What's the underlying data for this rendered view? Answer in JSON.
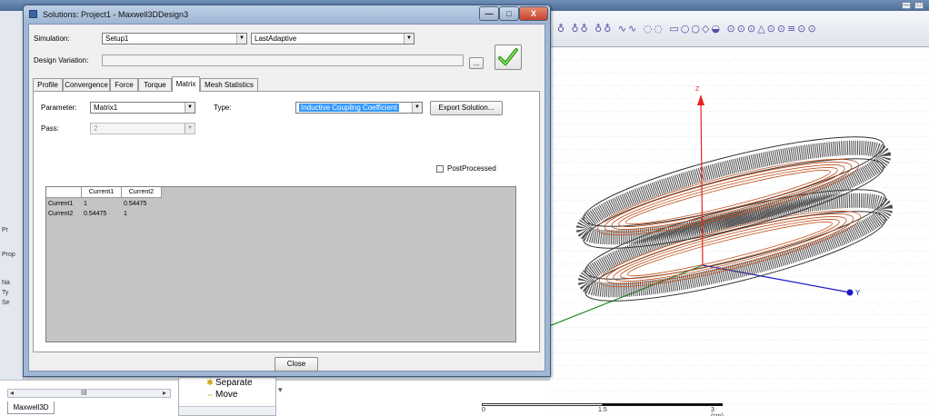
{
  "window": {
    "title": "Solutions: Project1 - Maxwell3DDesign3",
    "minimize_glyph": "—",
    "maximize_glyph": "□",
    "close_glyph": "X"
  },
  "form": {
    "simulation_label": "Simulation:",
    "simulation_value": "Setup1",
    "adaptive_value": "LastAdaptive",
    "design_variation_label": "Design Variation:",
    "ellipsis_label": "...",
    "apply_icon": "green-checkmark-icon"
  },
  "tabs": [
    {
      "label": "Profile",
      "active": false
    },
    {
      "label": "Convergence",
      "active": false
    },
    {
      "label": "Force",
      "active": false
    },
    {
      "label": "Torque",
      "active": false
    },
    {
      "label": "Matrix",
      "active": true
    },
    {
      "label": "Mesh Statistics",
      "active": false
    }
  ],
  "matrix": {
    "parameter_label": "Parameter:",
    "parameter_value": "Matrix1",
    "type_label": "Type:",
    "type_value": "Inductive Coupling Coefficient",
    "export_label": "Export Solution...",
    "pass_label": "Pass:",
    "pass_value": "2",
    "postprocessed_label": "PostProcessed",
    "postprocessed_checked": false,
    "columns": [
      "Current1",
      "Current2"
    ],
    "rows": [
      {
        "label": "Current1",
        "values": [
          "1",
          "0.54475"
        ]
      },
      {
        "label": "Current2",
        "values": [
          "0.54475",
          "1"
        ]
      }
    ]
  },
  "close_label": "Close",
  "background": {
    "left_labels": [
      "Pr",
      "Prop",
      "Na",
      "Ty",
      "Se"
    ],
    "tree": {
      "item1": "Separate",
      "item2": "Move",
      "dropdown_glyph": "▾"
    },
    "left_tab": "Maxwell3D",
    "scroll_left": "◂",
    "scroll_mid": "III",
    "scroll_right": "▸",
    "toolbar_glyphs": "♁ ♁♁ ♁♁ ∿∿ ◌◌ ▭○○◇◒ ⊙⊙⊙△⊙⊙≡⊙⊙",
    "axis_labels": {
      "z": "Z",
      "y": "Y"
    },
    "ruler": {
      "tick0": "0",
      "tick1": "1.5",
      "tick2": "3 (cm)"
    }
  },
  "colors": {
    "coil": "#c0501c",
    "ring": "#555555",
    "axis_z": "#e8251f",
    "axis_y": "#1d1ac8",
    "axis_x": "#1c8a1c",
    "highlight": "#3399ff",
    "dialog_frame": "#9fb7d5"
  }
}
